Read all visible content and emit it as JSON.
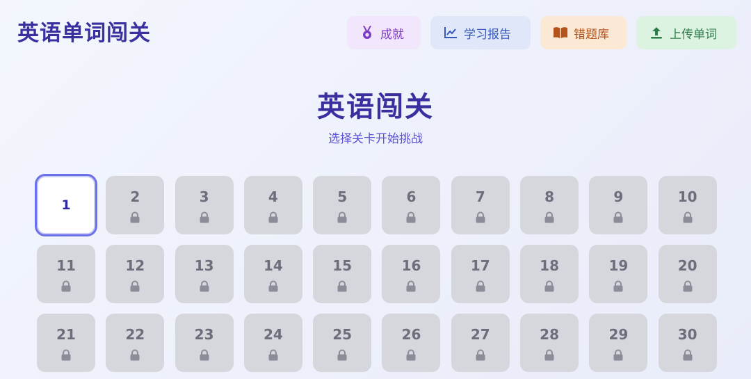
{
  "header": {
    "app_title": "英语单词闯关",
    "buttons": {
      "achievements": "成就",
      "report": "学习报告",
      "wrong_bank": "错题库",
      "upload": "上传单词"
    }
  },
  "hero": {
    "title": "英语闯关",
    "subtitle": "选择关卡开始挑战"
  },
  "levels": [
    {
      "n": "1",
      "locked": false
    },
    {
      "n": "2",
      "locked": true
    },
    {
      "n": "3",
      "locked": true
    },
    {
      "n": "4",
      "locked": true
    },
    {
      "n": "5",
      "locked": true
    },
    {
      "n": "6",
      "locked": true
    },
    {
      "n": "7",
      "locked": true
    },
    {
      "n": "8",
      "locked": true
    },
    {
      "n": "9",
      "locked": true
    },
    {
      "n": "10",
      "locked": true
    },
    {
      "n": "11",
      "locked": true
    },
    {
      "n": "12",
      "locked": true
    },
    {
      "n": "13",
      "locked": true
    },
    {
      "n": "14",
      "locked": true
    },
    {
      "n": "15",
      "locked": true
    },
    {
      "n": "16",
      "locked": true
    },
    {
      "n": "17",
      "locked": true
    },
    {
      "n": "18",
      "locked": true
    },
    {
      "n": "19",
      "locked": true
    },
    {
      "n": "20",
      "locked": true
    },
    {
      "n": "21",
      "locked": true
    },
    {
      "n": "22",
      "locked": true
    },
    {
      "n": "23",
      "locked": true
    },
    {
      "n": "24",
      "locked": true
    },
    {
      "n": "25",
      "locked": true
    },
    {
      "n": "26",
      "locked": true
    },
    {
      "n": "27",
      "locked": true
    },
    {
      "n": "28",
      "locked": true
    },
    {
      "n": "29",
      "locked": true
    },
    {
      "n": "30",
      "locked": true
    }
  ],
  "icons": {
    "achievements": "medal-icon",
    "report": "line-chart-icon",
    "wrong_bank": "book-icon",
    "upload": "upload-icon",
    "locked_level": "lock-icon"
  },
  "colors": {
    "brand": "#3a2f9e",
    "accent": "#6b6fe8",
    "locked_tile": "#d6d7dd"
  }
}
